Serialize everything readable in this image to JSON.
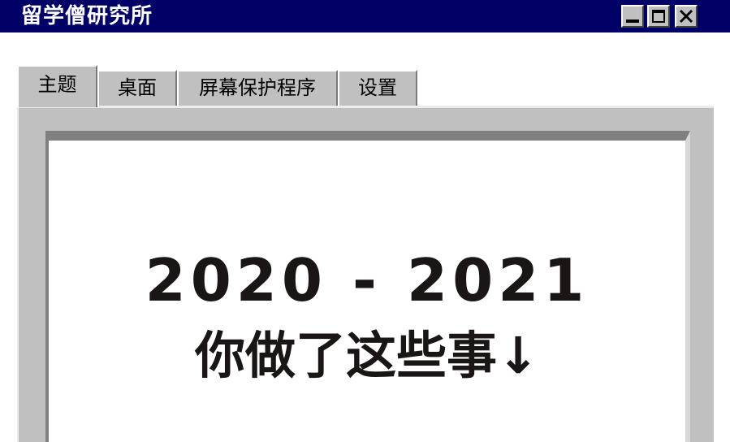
{
  "window": {
    "title": "留学僧研究所",
    "titlebar_color": "#010066"
  },
  "tabs": [
    {
      "label": "主题",
      "active": true
    },
    {
      "label": "桌面",
      "active": false
    },
    {
      "label": "屏幕保护程序",
      "active": false
    },
    {
      "label": "设置",
      "active": false
    }
  ],
  "screen": {
    "headline": "2020 - 2021",
    "subheadline": "你做了这些事↓"
  },
  "controls": {
    "minimize_icon": "minimize-icon",
    "maximize_icon": "maximize-icon",
    "close_icon": "close-icon"
  }
}
